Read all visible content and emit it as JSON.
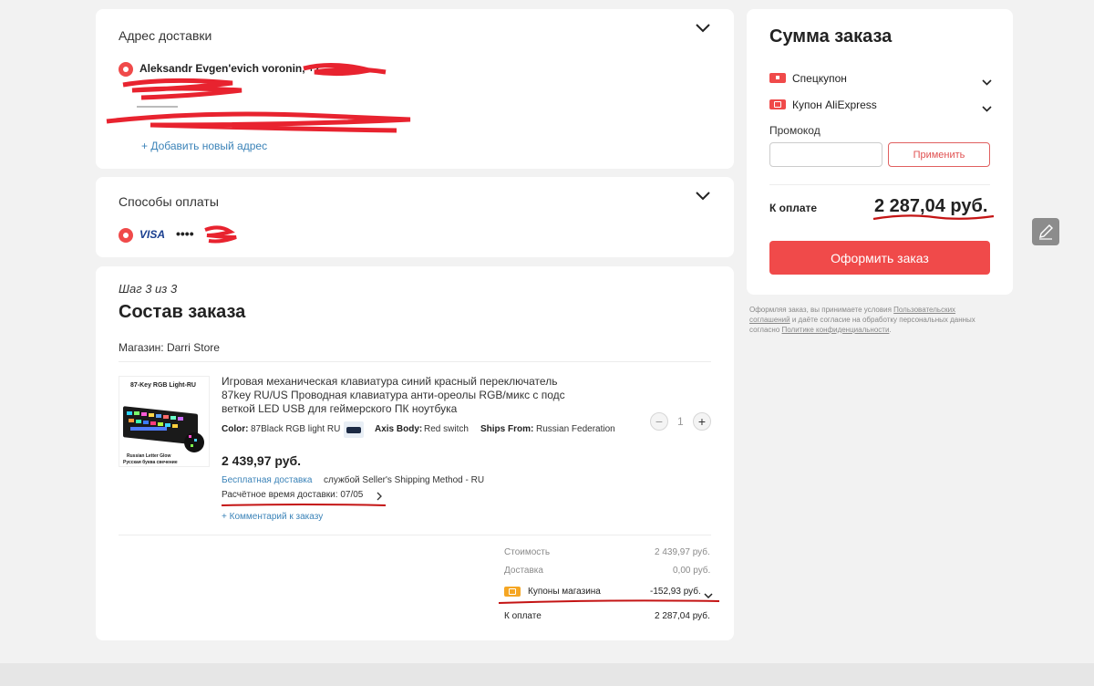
{
  "delivery": {
    "title": "Адрес доставки",
    "name": "Aleksandr Evgen'evich voronin, +7",
    "add_address": "+ Добавить новый адрес"
  },
  "payment": {
    "title": "Способы оплаты",
    "card_brand": "VISA",
    "card_mask": "••••"
  },
  "order": {
    "step": "Шаг 3 из 3",
    "title": "Состав заказа",
    "store": "Магазин: Darri Store",
    "product": {
      "image_title": "87-Key RGB Light-RU",
      "image_caption_1": "Russian Letter Glow",
      "image_caption_2": "Русская буква свечение",
      "title_line1": "Игровая механическая клавиатура синий красный переключатель",
      "title_line2": "87key RU/US Проводная клавиатура анти-ореолы RGB/микс с подс",
      "title_line3": "веткой LED USB для геймерского ПК ноутбука",
      "color_label": "Color:",
      "color_value": "87Black RGB light RU",
      "axis_label": "Axis Body:",
      "axis_value": "Red switch",
      "ships_label": "Ships From:",
      "ships_value": "Russian Federation",
      "quantity": "1",
      "price": "2 439,97 руб.",
      "free_shipping": "Бесплатная доставка",
      "shipping_method": "службой Seller's Shipping Method - RU",
      "delivery_estimate": "Расчётное время доставки: 07/05",
      "comment": "+ Комментарий к заказу"
    },
    "summary": {
      "cost_label": "Стоимость",
      "cost_value": "2 439,97 руб.",
      "delivery_label": "Доставка",
      "delivery_value": "0,00 руб.",
      "coupons_label": "Купоны магазина",
      "coupons_value": "-152,93 руб.",
      "total_label": "К оплате",
      "total_value": "2 287,04 руб."
    }
  },
  "sidebar": {
    "title": "Сумма заказа",
    "special_coupon": "Спецкупон",
    "ali_coupon": "Купон AliExpress",
    "promo_label": "Промокод",
    "promo_placeholder": "",
    "apply_button": "Применить",
    "total_label": "К оплате",
    "total_value": "2 287,04 руб.",
    "checkout_button": "Оформить заказ",
    "legal_line1a": "Оформляя заказ, вы принимаете условия ",
    "legal_link1a": "Пользовательских",
    "legal_link1b": "соглашений",
    "legal_line2": " и даёте согласие на обработку персональных данных",
    "legal_line3a": "согласно ",
    "legal_link2": "Политике конфиденциальности",
    "legal_line3b": "."
  },
  "colors": {
    "accent": "#f04a4a",
    "link": "#3b83b8",
    "coupon_orange": "#f5a623",
    "scribble": "#e8232f"
  },
  "icons": [
    "chevron-down-icon",
    "radio-selected-icon",
    "visa-logo",
    "minus-icon",
    "plus-icon",
    "chevron-right-icon",
    "coupon-icon",
    "edit-icon"
  ]
}
